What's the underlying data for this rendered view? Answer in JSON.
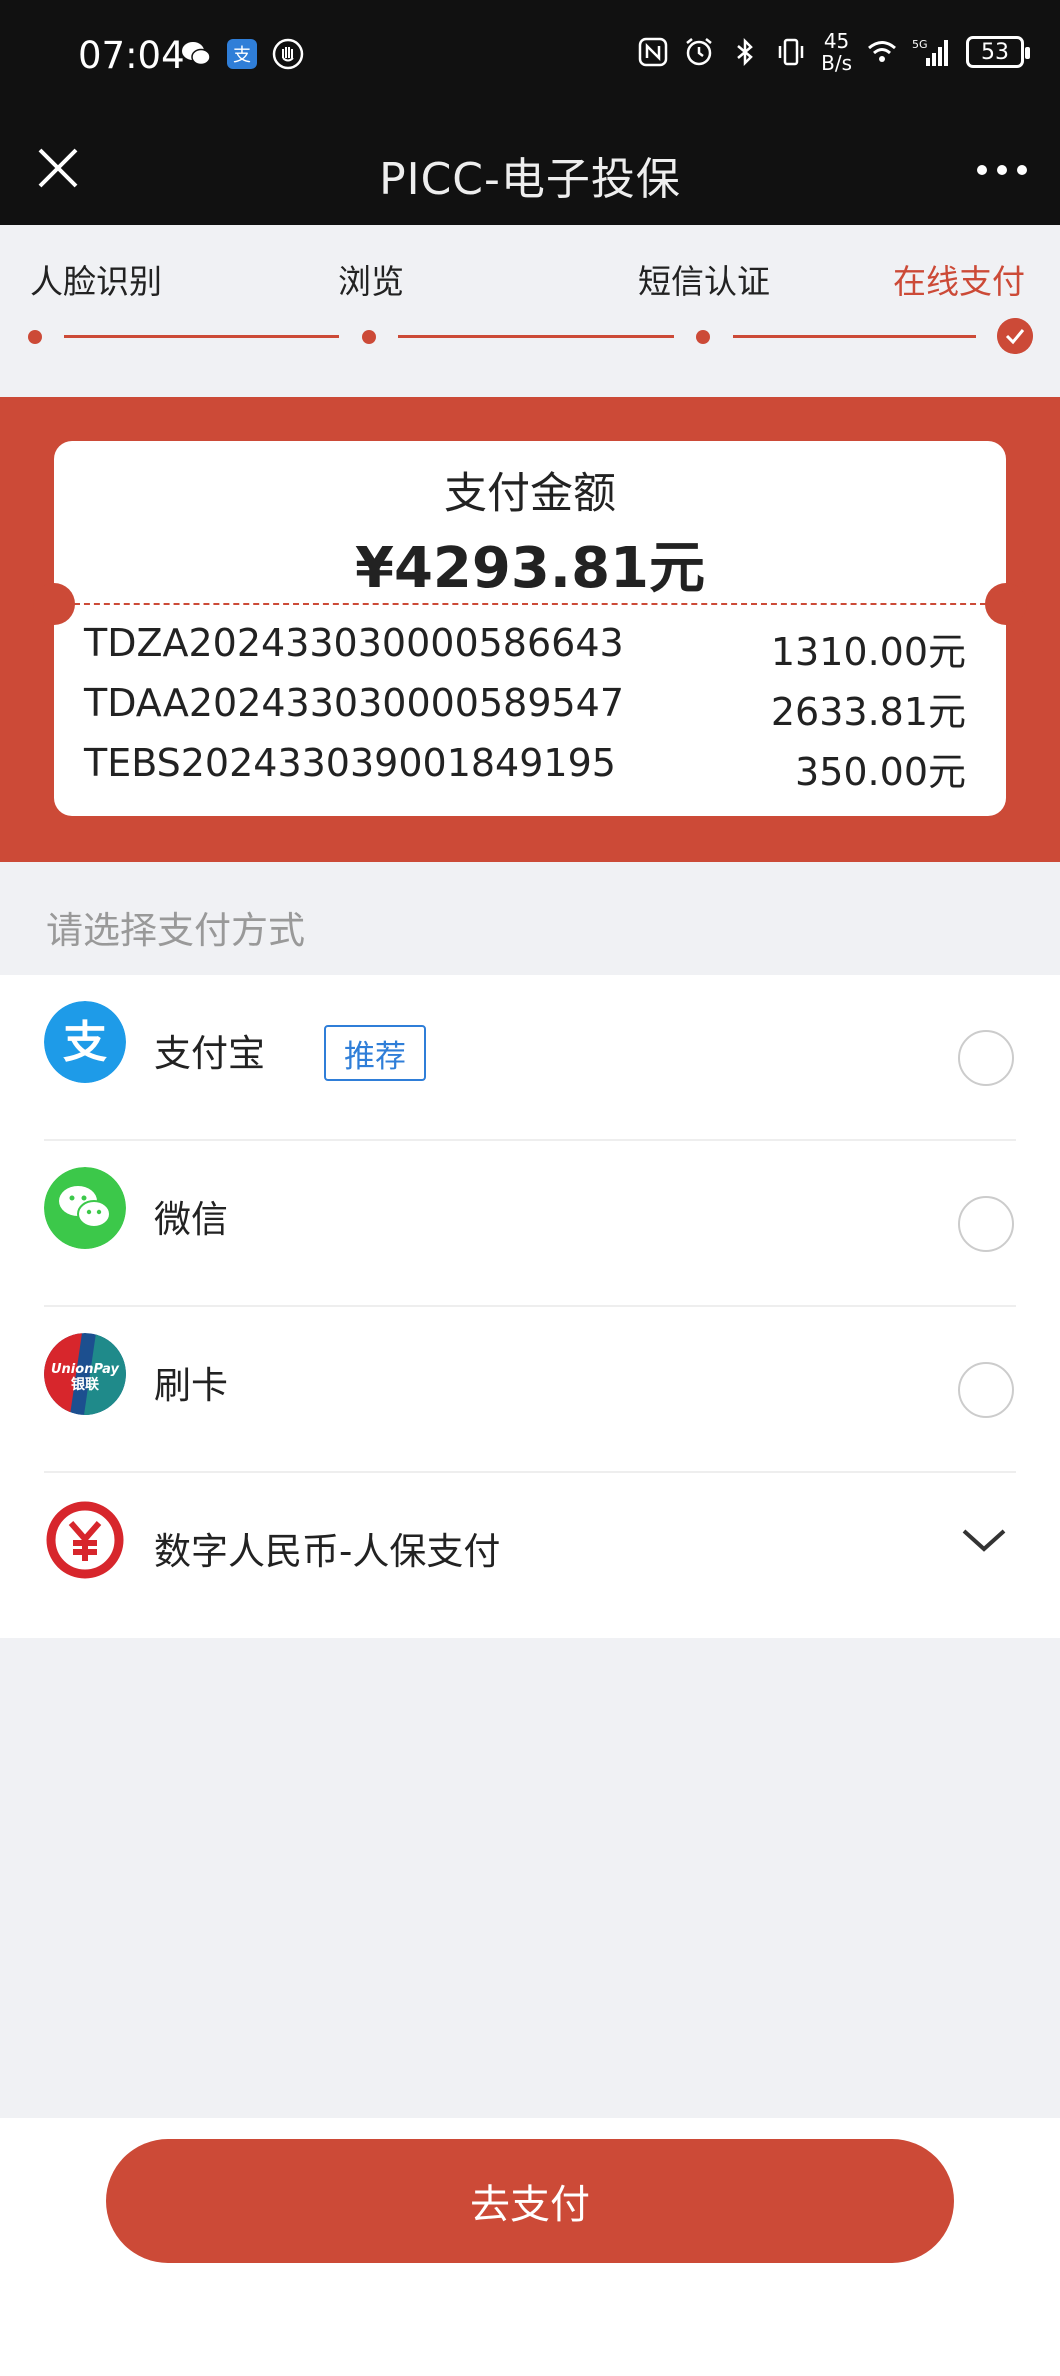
{
  "status_bar": {
    "time": "07:04",
    "net_speed_value": "45",
    "net_speed_unit": "B/s",
    "battery": "53"
  },
  "nav": {
    "title": "PICC-电子投保"
  },
  "steps": [
    {
      "label": "人脸识别",
      "state": "done"
    },
    {
      "label": "浏览",
      "state": "done"
    },
    {
      "label": "短信认证",
      "state": "done"
    },
    {
      "label": "在线支付",
      "state": "current"
    }
  ],
  "payment": {
    "label": "支付金额",
    "amount": "¥4293.81元",
    "policies": [
      {
        "number": "TDZA202433030000586643",
        "amount": "1310.00元"
      },
      {
        "number": "TDAA202433030000589547",
        "amount": "2633.81元"
      },
      {
        "number": "TEBS202433039001849195",
        "amount": "350.00元"
      }
    ]
  },
  "select_title": "请选择支付方式",
  "methods": [
    {
      "name": "支付宝",
      "tag": "推荐",
      "icon": "alipay-icon"
    },
    {
      "name": "微信",
      "icon": "wechat-icon"
    },
    {
      "name": "刷卡",
      "icon": "unionpay-icon",
      "logo_text_1": "UnionPay",
      "logo_text_2": "银联"
    },
    {
      "name": "数字人民币-人保支付",
      "icon": "digital-rmb-icon"
    }
  ],
  "pay_button": "去支付",
  "colors": {
    "accent": "#cc4a37",
    "alipay": "#1e9be8",
    "wechat": "#3cc84a",
    "tag_blue": "#2f7ed8"
  }
}
